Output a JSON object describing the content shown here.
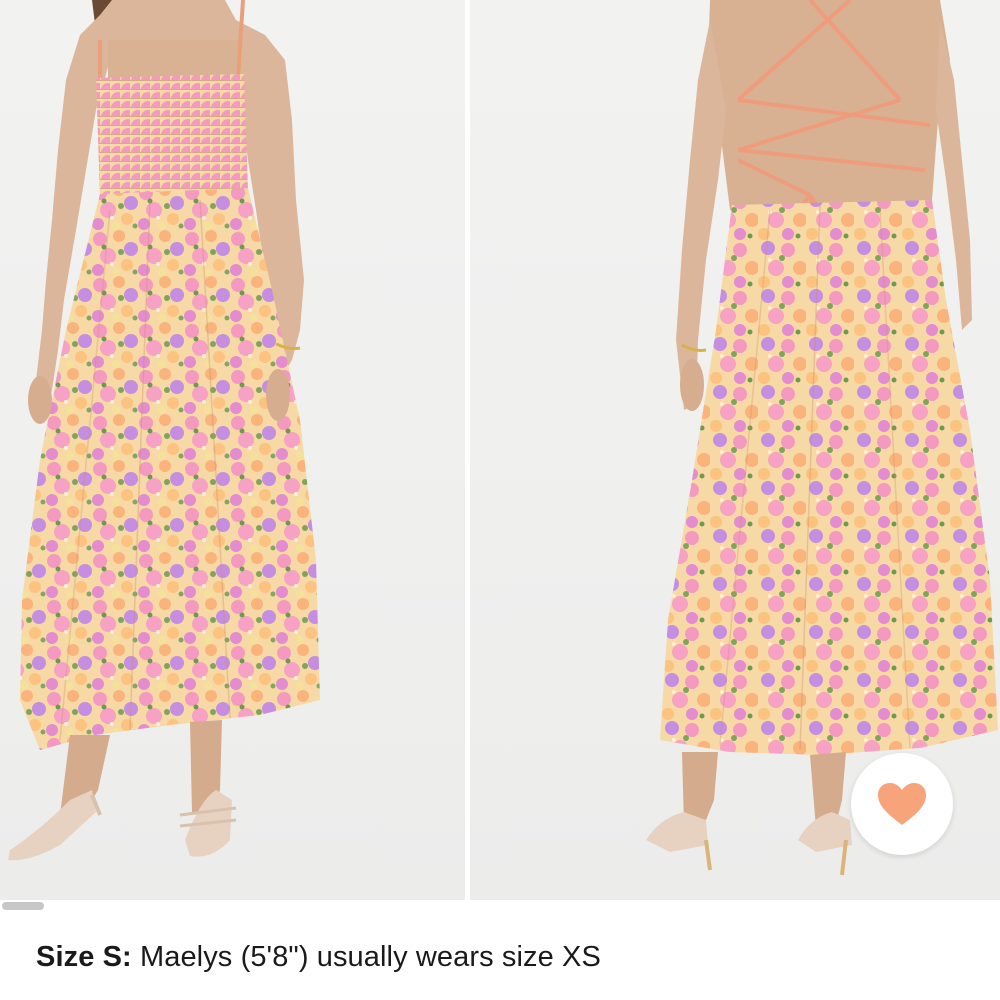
{
  "gallery": {
    "images": [
      {
        "name": "front-view",
        "alt": "Floral maxi dress, front view"
      },
      {
        "name": "back-view",
        "alt": "Floral maxi dress, back view with lace-up back"
      }
    ],
    "favorite_icon": "heart-icon",
    "accent_color": "#f7a47b"
  },
  "size_info": {
    "label": "Size S:",
    "text": " Maelys (5'8\") usually wears size XS"
  }
}
